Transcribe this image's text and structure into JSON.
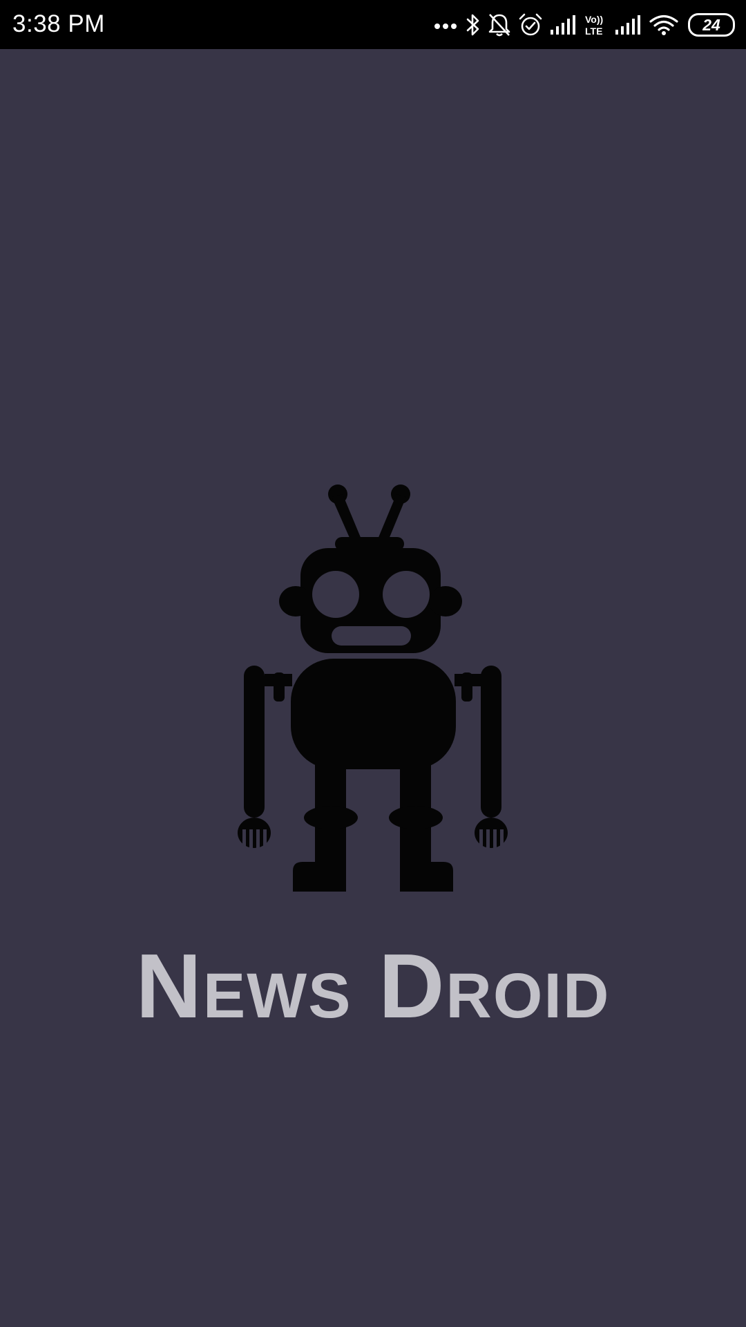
{
  "status_bar": {
    "time": "3:38 PM",
    "icons": [
      "more-notifications-icon",
      "bluetooth-icon",
      "notifications-off-icon",
      "alarm-icon",
      "signal-icon",
      "volte-icon",
      "signal-icon",
      "wifi-icon",
      "battery-icon"
    ],
    "volte_top": "Vo))",
    "volte_bottom": "LTE",
    "battery_level": "24"
  },
  "splash": {
    "logo": "robot-icon",
    "app_name": "News Droid"
  },
  "colors": {
    "background": "#383547",
    "status_bar": "#000000",
    "robot": "#050505",
    "app_name": "#c2c1c8"
  }
}
